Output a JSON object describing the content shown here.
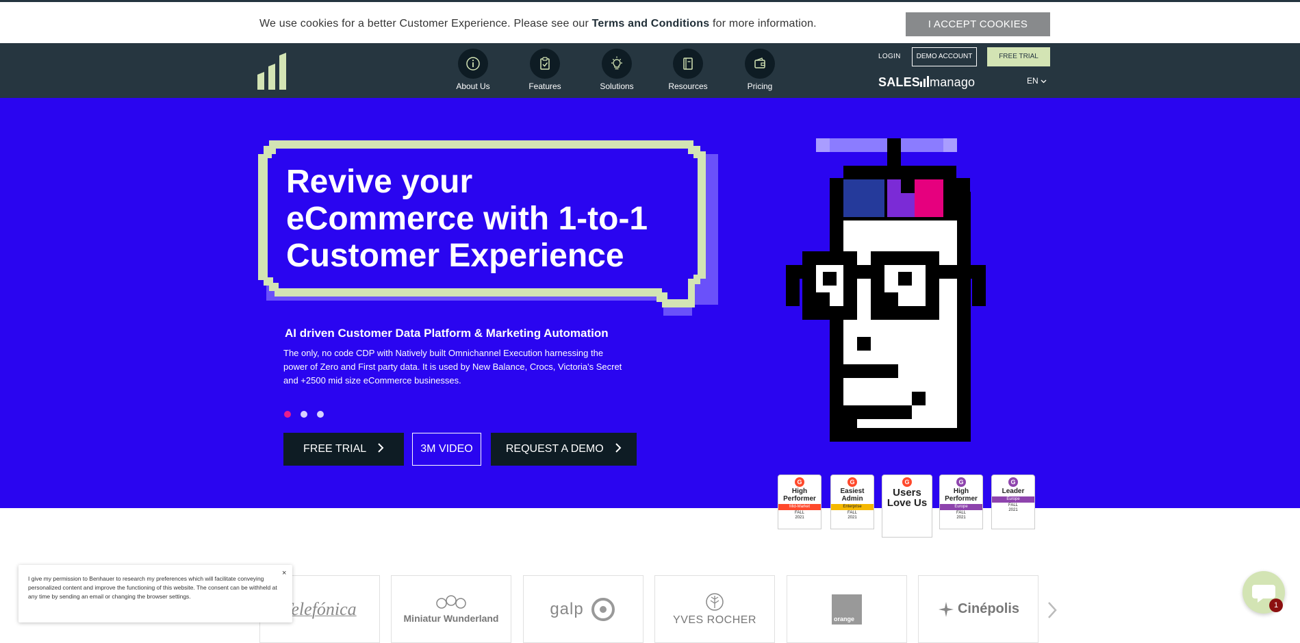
{
  "cookie": {
    "text_before": "We use cookies for a better Customer Experience. Please see our ",
    "terms_link": "Terms and Conditions",
    "text_after": " for more information.",
    "accept_label": "I ACCEPT COOKIES"
  },
  "header": {
    "nav": [
      {
        "label": "About Us",
        "icon": "info-icon"
      },
      {
        "label": "Features",
        "icon": "clipboard-check-icon"
      },
      {
        "label": "Solutions",
        "icon": "lightbulb-icon"
      },
      {
        "label": "Resources",
        "icon": "book-icon"
      },
      {
        "label": "Pricing",
        "icon": "wallet-icon"
      }
    ],
    "login": "LOGIN",
    "demo_account": "DEMO ACCOUNT",
    "free_trial": "FREE TRIAL",
    "brand_bold": "SALES",
    "brand_thin": "manago",
    "language": "EN"
  },
  "hero": {
    "title": "Revive your eCommerce with 1-to-1 Customer Experience",
    "subtitle": "AI driven Customer Data Platform & Marketing Automation",
    "description": "The only, no code CDP with Natively built Omnichannel Execution harnessing the power of Zero and First party data. It is used by New Balance, Crocs, Victoria's Secret and +2500 mid size eCommerce businesses.",
    "btn_free_trial": "FREE TRIAL",
    "btn_video": "3M VIDEO",
    "btn_demo": "REQUEST A DEMO",
    "slide_active": 1,
    "slide_count": 3
  },
  "badges": [
    {
      "title": "High Performer",
      "segment": "Mid-Market",
      "season": "FALL",
      "year": "2021",
      "color": "#ff492c"
    },
    {
      "title": "Easiest Admin",
      "segment": "Enterprise",
      "season": "FALL",
      "year": "2021",
      "color": "#f5b800"
    },
    {
      "title": "Users Love Us",
      "segment": "",
      "season": "",
      "year": "",
      "color": "#ff492c"
    },
    {
      "title": "High Performer",
      "segment": "Europe",
      "season": "FALL",
      "year": "2021",
      "color": "#8e44ad"
    },
    {
      "title": "Leader",
      "segment": "Europe",
      "season": "FALL",
      "year": "2021",
      "color": "#8e44ad"
    }
  ],
  "clients": [
    "Telefónica",
    "Miniatur Wunderland",
    "galp",
    "YVES ROCHER",
    "orange",
    "Cinépolis"
  ],
  "consent": {
    "text": "I give my permission to Benhauer to research my preferences which will facilitate conveying personalized content and improve the functioning of this website. The consent can be withheld at any time by sending an email or changing the browser settings.",
    "close": "×"
  },
  "chat": {
    "unread": "1"
  },
  "colors": {
    "hero_bg": "#2a05f0",
    "header_bg": "#263640",
    "accent_green": "#d3e4b4",
    "accent_pink": "#e91e8c"
  }
}
